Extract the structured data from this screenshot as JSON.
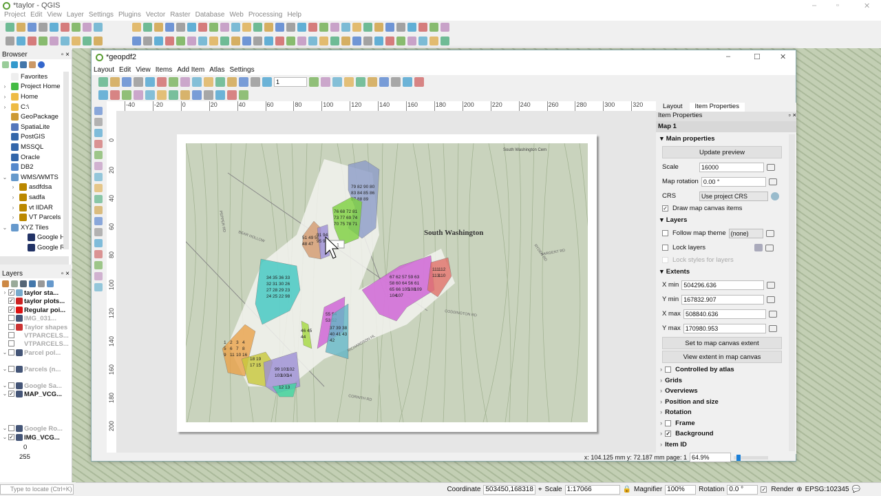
{
  "app": {
    "title": "*taylor - QGIS",
    "menu": [
      "Project",
      "Edit",
      "View",
      "Layer",
      "Settings",
      "Plugins",
      "Vector",
      "Raster",
      "Database",
      "Web",
      "Processing",
      "Help"
    ]
  },
  "browser": {
    "title": "Browser",
    "items": [
      {
        "label": "Favorites",
        "icon": "star-icon"
      },
      {
        "label": "Project Home",
        "icon": "project-home-icon"
      },
      {
        "label": "Home",
        "icon": "folder-icon"
      },
      {
        "label": "C:\\",
        "icon": "folder-icon"
      },
      {
        "label": "GeoPackage",
        "icon": "geopackage-icon"
      },
      {
        "label": "SpatiaLite",
        "icon": "spatialite-icon"
      },
      {
        "label": "PostGIS",
        "icon": "postgis-icon"
      },
      {
        "label": "MSSQL",
        "icon": "mssql-icon"
      },
      {
        "label": "Oracle",
        "icon": "oracle-icon"
      },
      {
        "label": "DB2",
        "icon": "db2-icon"
      },
      {
        "label": "WMS/WMTS",
        "icon": "globe-icon"
      },
      {
        "label": "asdfdsa",
        "icon": "wms-icon"
      },
      {
        "label": "sadfa",
        "icon": "wms-icon"
      },
      {
        "label": "vt lIDAR",
        "icon": "wms-icon"
      },
      {
        "label": "VT Parcels",
        "icon": "wms-icon"
      },
      {
        "label": "XYZ Tiles",
        "icon": "globe-icon"
      },
      {
        "label": "Google Hy",
        "icon": "raster-icon"
      },
      {
        "label": "Google Ro",
        "icon": "raster-icon"
      }
    ]
  },
  "layers": {
    "title": "Layers",
    "items": [
      {
        "label": "taylor sta...",
        "checked": true,
        "bold": true
      },
      {
        "label": "taylor plots...",
        "checked": true,
        "bold": true
      },
      {
        "label": "Regular poi...",
        "checked": true,
        "bold": true
      },
      {
        "label": "IMG_031...",
        "checked": false
      },
      {
        "label": "Taylor shapes",
        "checked": false
      },
      {
        "label": "VTPARCELS...",
        "checked": false
      },
      {
        "label": "VTPARCELS...",
        "checked": false
      },
      {
        "label": "Parcel pol...",
        "checked": false
      },
      {
        "label": "Parcels (n...",
        "checked": false
      },
      {
        "label": "Google Sa...",
        "checked": false
      },
      {
        "label": "MAP_VCG...",
        "checked": true,
        "bold": true
      },
      {
        "label": "Google Ro...",
        "checked": false
      },
      {
        "label": "IMG_VCG...",
        "checked": true,
        "bold": true
      }
    ],
    "legend_min": "0",
    "legend_max": "255"
  },
  "locator": {
    "placeholder": "Type to locate (Ctrl+K)"
  },
  "status": {
    "coordinate_label": "Coordinate",
    "coordinate": "503450,168318",
    "scale_label": "Scale",
    "scale": "1:17066",
    "magnifier_label": "Magnifier",
    "magnifier": "100%",
    "rotation_label": "Rotation",
    "rotation": "0.0 °",
    "render_label": "Render",
    "crs": "EPSG:102345"
  },
  "layout": {
    "title": "*geopdf2",
    "menu": [
      "Layout",
      "Edit",
      "View",
      "Items",
      "Add Item",
      "Atlas",
      "Settings"
    ],
    "atlas_page": "1",
    "hruler": [
      "-40",
      "-20",
      "0",
      "20",
      "40",
      "60",
      "80",
      "100",
      "120",
      "140",
      "160",
      "180",
      "200",
      "220",
      "240",
      "260",
      "280",
      "300",
      "320"
    ],
    "vruler": [
      "0",
      "20",
      "40",
      "60",
      "80",
      "100",
      "120",
      "140",
      "160",
      "180",
      "200"
    ],
    "cursor_pos": "x: 104.125 mm y: 72.187 mm page: 1",
    "zoom": "64.9%"
  },
  "map": {
    "town": "South Washington",
    "cemetery": "South Washington Cem",
    "roads": [
      "BEAR HOLLOW",
      "CODDINGTON RD",
      "SARGENT RD",
      "RICHARDSON HL",
      "CORINTH RD",
      "RYDER RD",
      "PEPPER RD"
    ],
    "tooltip": "1",
    "parcels": [
      {
        "color": "#8c9cc8",
        "labels": [
          "79",
          "82",
          "90",
          "80",
          "83",
          "84",
          "85",
          "86",
          "87",
          "88",
          "89"
        ]
      },
      {
        "color": "#7dd13f",
        "labels": [
          "76",
          "68",
          "72",
          "81",
          "73",
          "77",
          "69",
          "74",
          "70",
          "75",
          "78",
          "71"
        ]
      },
      {
        "color": "#d49a6e",
        "labels": [
          "51",
          "49",
          "50",
          "48",
          "47"
        ]
      },
      {
        "color": "#9d8fd6",
        "labels": [
          "91",
          "94",
          "95",
          "97"
        ]
      },
      {
        "color": "#3fc8c2",
        "labels": [
          "34",
          "35",
          "36",
          "33",
          "32",
          "31",
          "30",
          "26",
          "27",
          "28",
          "29",
          "23",
          "24",
          "25",
          "22",
          "98"
        ]
      },
      {
        "color": "#cf5fd6",
        "labels": [
          "67",
          "62",
          "57",
          "59",
          "63",
          "58",
          "60",
          "64",
          "56",
          "61",
          "65",
          "66",
          "105",
          "108",
          "109",
          "104",
          "107"
        ]
      },
      {
        "color": "#e07068",
        "labels": [
          "111",
          "112",
          "113",
          "110"
        ]
      },
      {
        "color": "#cf5fd6",
        "labels": [
          "55",
          "54",
          "53",
          "52"
        ]
      },
      {
        "color": "#63b6c6",
        "labels": [
          "37",
          "39",
          "38",
          "40",
          "41",
          "43",
          "42"
        ]
      },
      {
        "color": "#a6d940",
        "labels": [
          "46",
          "45",
          "44"
        ]
      },
      {
        "color": "#eaa24a",
        "labels": [
          "1",
          "2",
          "3",
          "4",
          "5",
          "6",
          "7",
          "8",
          "9",
          "11",
          "10",
          "16"
        ]
      },
      {
        "color": "#c8c83a",
        "labels": [
          "18",
          "19",
          "17",
          "15"
        ]
      },
      {
        "color": "#9d8fd6",
        "labels": [
          "99",
          "101",
          "102",
          "103",
          "100",
          "14"
        ]
      },
      {
        "color": "#3fd6a0",
        "labels": [
          "12",
          "13"
        ]
      }
    ]
  },
  "props": {
    "tabs": [
      "Layout",
      "Item Properties"
    ],
    "title": "Item Properties",
    "item": "Map 1",
    "main_section": "Main properties",
    "update_preview": "Update preview",
    "scale_label": "Scale",
    "scale": "16000",
    "rotation_label": "Map rotation",
    "rotation": "0.00 °",
    "crs_label": "CRS",
    "crs": "Use project CRS",
    "draw_canvas": "Draw map canvas items",
    "layers_section": "Layers",
    "follow_theme": "Follow map theme",
    "theme": "(none)",
    "lock_layers": "Lock layers",
    "lock_styles": "Lock styles for layers",
    "extents_section": "Extents",
    "xmin_label": "X min",
    "xmin": "504296.636",
    "ymin_label": "Y min",
    "ymin": "167832.907",
    "xmax_label": "X max",
    "xmax": "508840.636",
    "ymax_label": "Y max",
    "ymax": "170980.953",
    "set_extent": "Set to map canvas extent",
    "view_extent": "View extent in map canvas",
    "collapsed": [
      "Controlled by atlas",
      "Grids",
      "Overviews",
      "Position and size",
      "Rotation",
      "Frame",
      "Background",
      "Item ID"
    ]
  }
}
